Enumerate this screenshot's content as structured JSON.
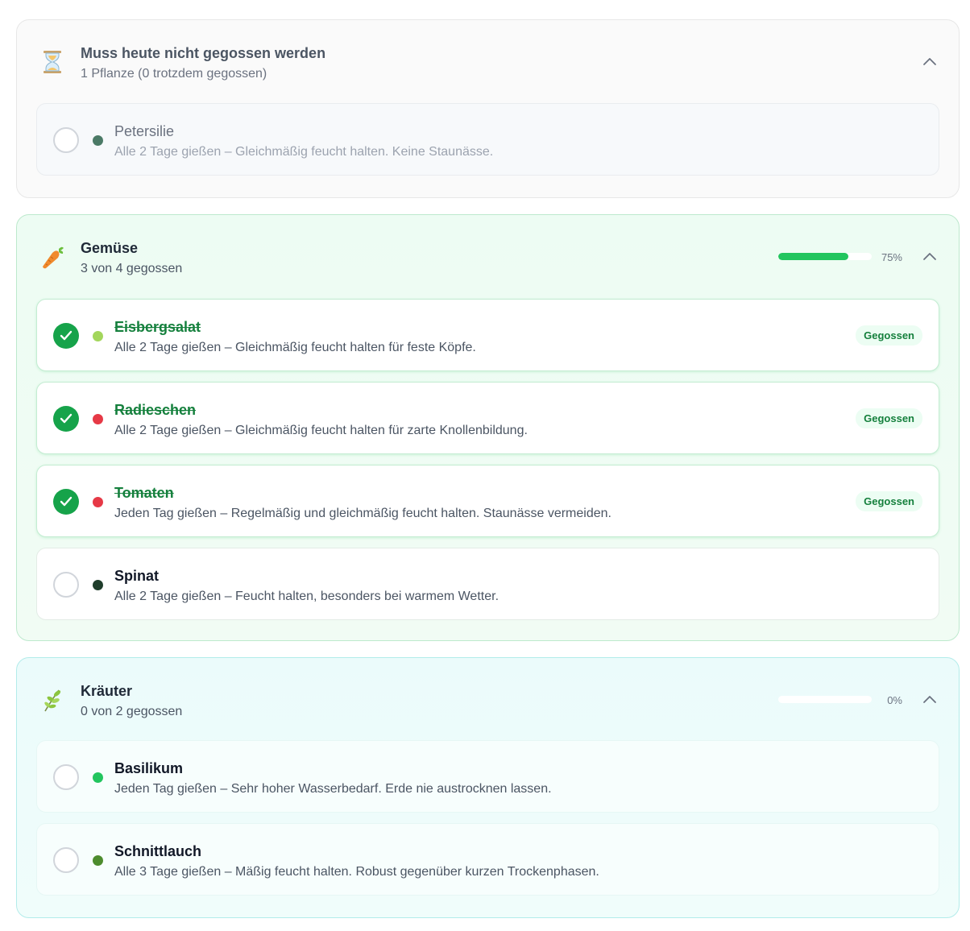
{
  "sections": [
    {
      "icon": "hourglass-icon",
      "title": "Muss heute nicht gegossen werden",
      "subtitle": "1 Pflanze (0 trotzdem gegossen)",
      "items": [
        {
          "name": "Petersilie",
          "desc": "Alle 2 Tage gießen – Gleichmäßig feucht halten. Keine Staunässe.",
          "color": "#4b7a66",
          "done": false
        }
      ]
    },
    {
      "icon": "carrot-icon",
      "title": "Gemüse",
      "subtitle": "3 von 4 gegossen",
      "progress_fraction": 0.75,
      "progress_label": "75%",
      "items": [
        {
          "name": "Eisbergsalat",
          "desc": "Alle 2 Tage gießen – Gleichmäßig feucht halten für feste Köpfe.",
          "color": "#a3d65c",
          "done": true,
          "badge": "Gegossen"
        },
        {
          "name": "Radieschen",
          "desc": "Alle 2 Tage gießen – Gleichmäßig feucht halten für zarte Knollenbildung.",
          "color": "#e63946",
          "done": true,
          "badge": "Gegossen"
        },
        {
          "name": "Tomaten",
          "desc": "Jeden Tag gießen – Regelmäßig und gleichmäßig feucht halten. Staunässe vermeiden.",
          "color": "#e63946",
          "done": true,
          "badge": "Gegossen"
        },
        {
          "name": "Spinat",
          "desc": "Alle 2 Tage gießen – Feucht halten, besonders bei warmem Wetter.",
          "color": "#1f3d2b",
          "done": false
        }
      ]
    },
    {
      "icon": "herb-icon",
      "title": "Kräuter",
      "subtitle": "0 von 2 gegossen",
      "progress_fraction": 0,
      "progress_label": "0%",
      "items": [
        {
          "name": "Basilikum",
          "desc": "Jeden Tag gießen – Sehr hoher Wasserbedarf. Erde nie austrocknen lassen.",
          "color": "#22c55e",
          "done": false
        },
        {
          "name": "Schnittlauch",
          "desc": "Alle 3 Tage gießen – Mäßig feucht halten. Robust gegenüber kurzen Trockenphasen.",
          "color": "#4d8c2e",
          "done": false
        }
      ]
    }
  ]
}
